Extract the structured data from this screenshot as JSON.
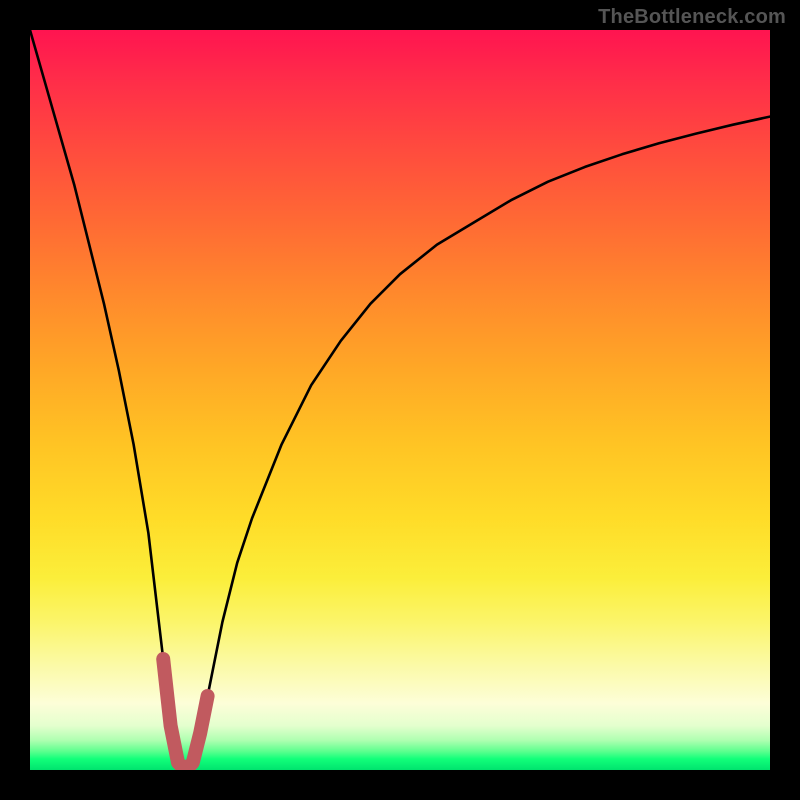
{
  "watermark": "TheBottleneck.com",
  "frame_color": "#000000",
  "chart_data": {
    "type": "line",
    "title": "",
    "xlabel": "",
    "ylabel": "",
    "xlim": [
      0,
      100
    ],
    "ylim": [
      0,
      100
    ],
    "grid": false,
    "series": [
      {
        "name": "bottleneck-curve",
        "color": "#000000",
        "x": [
          0,
          2,
          4,
          6,
          8,
          10,
          12,
          14,
          16,
          18,
          19,
          20,
          21,
          22,
          23,
          24,
          26,
          28,
          30,
          34,
          38,
          42,
          46,
          50,
          55,
          60,
          65,
          70,
          75,
          80,
          85,
          90,
          95,
          100
        ],
        "values": [
          100,
          93,
          86,
          79,
          71,
          63,
          54,
          44,
          32,
          15,
          6,
          1,
          0,
          1,
          5,
          10,
          20,
          28,
          34,
          44,
          52,
          58,
          63,
          67,
          71,
          74,
          77,
          79.5,
          81.5,
          83.2,
          84.7,
          86,
          87.2,
          88.3
        ]
      },
      {
        "name": "trough-highlight",
        "color": "#c15a5f",
        "x": [
          18,
          19,
          20,
          21,
          22,
          23,
          24
        ],
        "values": [
          15,
          6,
          1,
          0,
          1,
          5,
          10
        ]
      }
    ],
    "background_gradient_stops": [
      {
        "pos": 0.0,
        "color": "#ff1450"
      },
      {
        "pos": 0.16,
        "color": "#ff4b3e"
      },
      {
        "pos": 0.36,
        "color": "#ff8a2c"
      },
      {
        "pos": 0.56,
        "color": "#ffc424"
      },
      {
        "pos": 0.74,
        "color": "#fbee3a"
      },
      {
        "pos": 0.91,
        "color": "#fdfed8"
      },
      {
        "pos": 0.97,
        "color": "#5bff8e"
      },
      {
        "pos": 1.0,
        "color": "#00e36e"
      }
    ]
  }
}
